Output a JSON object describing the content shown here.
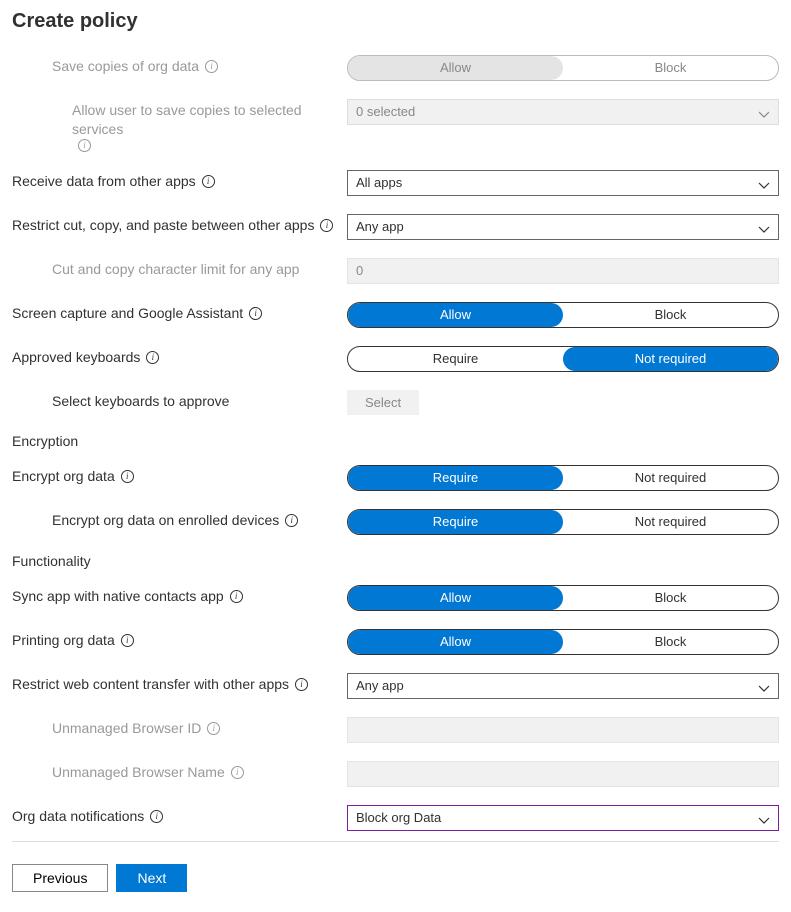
{
  "title": "Create policy",
  "rows": {
    "save_copies": {
      "label": "Save copies of org data",
      "options": [
        "Allow",
        "Block"
      ],
      "selected": "Allow"
    },
    "save_copies_services": {
      "label": "Allow user to save copies to selected services",
      "value": "0 selected"
    },
    "receive_data": {
      "label": "Receive data from other apps",
      "value": "All apps"
    },
    "restrict_ccp": {
      "label": "Restrict cut, copy, and paste between other apps",
      "value": "Any app"
    },
    "ccp_limit": {
      "label": "Cut and copy character limit for any app",
      "value": "0"
    },
    "screen_capture": {
      "label": "Screen capture and Google Assistant",
      "options": [
        "Allow",
        "Block"
      ],
      "selected": "Allow"
    },
    "approved_kb": {
      "label": "Approved keyboards",
      "options": [
        "Require",
        "Not required"
      ],
      "selected": "Not required"
    },
    "select_kb": {
      "label": "Select keyboards to approve",
      "button": "Select"
    },
    "section_encryption": "Encryption",
    "encrypt_org": {
      "label": "Encrypt org data",
      "options": [
        "Require",
        "Not required"
      ],
      "selected": "Require"
    },
    "encrypt_enrolled": {
      "label": "Encrypt org data on enrolled devices",
      "options": [
        "Require",
        "Not required"
      ],
      "selected": "Require"
    },
    "section_functionality": "Functionality",
    "sync_contacts": {
      "label": "Sync app with native contacts app",
      "options": [
        "Allow",
        "Block"
      ],
      "selected": "Allow"
    },
    "printing": {
      "label": "Printing org data",
      "options": [
        "Allow",
        "Block"
      ],
      "selected": "Allow"
    },
    "restrict_web": {
      "label": "Restrict web content transfer with other apps",
      "value": "Any app"
    },
    "browser_id": {
      "label": "Unmanaged Browser ID",
      "value": ""
    },
    "browser_name": {
      "label": "Unmanaged Browser Name",
      "value": ""
    },
    "notifications": {
      "label": "Org data notifications",
      "value": "Block org Data"
    }
  },
  "footer": {
    "previous": "Previous",
    "next": "Next"
  }
}
